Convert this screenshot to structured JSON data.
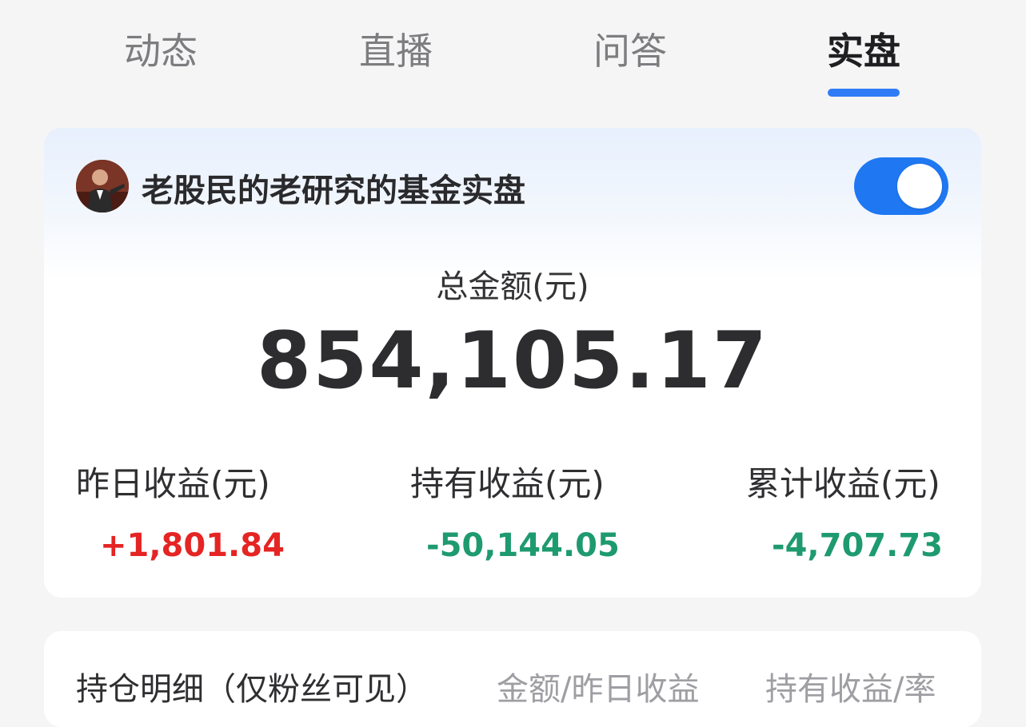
{
  "tabs": [
    {
      "label": "动态",
      "active": false
    },
    {
      "label": "直播",
      "active": false
    },
    {
      "label": "问答",
      "active": false
    },
    {
      "label": "实盘",
      "active": true
    }
  ],
  "portfolio": {
    "account_name": "老股民的老研究的基金实盘",
    "avatar": "avatar-photo",
    "toggle_on": true,
    "total_label": "总金额(元)",
    "total_value": "854,105.17",
    "stats": [
      {
        "label": "昨日收益(元)",
        "value": "+1,801.84",
        "trend": "up"
      },
      {
        "label": "持有收益(元)",
        "value": "-50,144.05",
        "trend": "down"
      },
      {
        "label": "累计收益(元)",
        "value": "-4,707.73",
        "trend": "down"
      }
    ]
  },
  "holdings": {
    "title": "持仓明细（仅粉丝可见）",
    "columns": [
      "金额/昨日收益",
      "持有收益/率"
    ]
  },
  "colors": {
    "accent": "#2f7cf6",
    "toggle": "#1f78f2",
    "gain": "#e52424",
    "loss": "#1e9a6f"
  }
}
